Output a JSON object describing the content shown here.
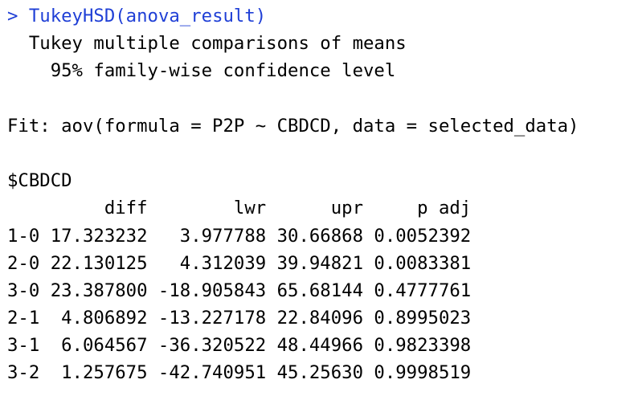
{
  "console": {
    "prompt_symbol": "> ",
    "command": "TukeyHSD(anova_result)",
    "output_title": "  Tukey multiple comparisons of means",
    "confidence_line": "    95% family-wise confidence level",
    "fit_line": "Fit: aov(formula = P2P ~ CBDCD, data = selected_data)",
    "group_label": "$CBDCD",
    "table_header": "         diff        lwr      upr     p adj",
    "rows": [
      {
        "label": "1-0",
        "text": "1-0 17.323232   3.977788 30.66868 0.0052392"
      },
      {
        "label": "2-0",
        "text": "2-0 22.130125   4.312039 39.94821 0.0083381"
      },
      {
        "label": "3-0",
        "text": "3-0 23.387800 -18.905843 65.68144 0.4777761"
      },
      {
        "label": "2-1",
        "text": "2-1  4.806892 -13.227178 22.84096 0.8995023"
      },
      {
        "label": "3-1",
        "text": "3-1  6.064567 -36.320522 48.44966 0.9823398"
      },
      {
        "label": "3-2",
        "text": "3-2  1.257675 -42.740951 45.25630 0.9998519"
      }
    ]
  },
  "colors": {
    "command": "#1f3fd6",
    "output": "#000000",
    "background": "#ffffff"
  }
}
